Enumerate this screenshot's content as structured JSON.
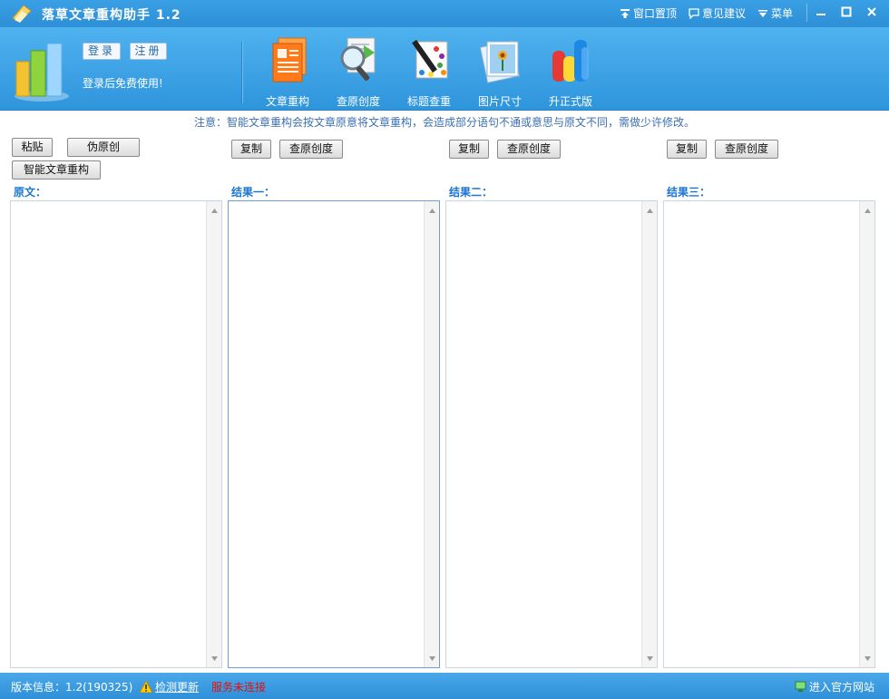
{
  "window": {
    "title": "落草文章重构助手 1.2",
    "actions": [
      {
        "label": "窗口置顶",
        "icon": "pin-icon"
      },
      {
        "label": "意见建议",
        "icon": "feedback-icon"
      },
      {
        "label": "菜单",
        "icon": "menu-chevron-icon"
      }
    ]
  },
  "account": {
    "login": "登录",
    "register": "注册",
    "hint": "登录后免费使用!"
  },
  "tools": [
    {
      "label": "文章重构",
      "icon": "document-icon"
    },
    {
      "label": "查原创度",
      "icon": "magnifier-icon"
    },
    {
      "label": "标题查重",
      "icon": "pen-palette-icon"
    },
    {
      "label": "图片尺寸",
      "icon": "picture-icon"
    },
    {
      "label": "升正式版",
      "icon": "upgrade-bars-icon"
    }
  ],
  "notice": "注意：智能文章重构会按文章原意将文章重构，会造成部分语句不通或意思与原文不同，需做少许修改。",
  "original": {
    "paste": "粘贴",
    "pseudo": "伪原创",
    "smart": "智能文章重构",
    "label": "原文："
  },
  "results": [
    {
      "label": "结果一：",
      "copy": "复制",
      "check": "查原创度"
    },
    {
      "label": "结果二：",
      "copy": "复制",
      "check": "查原创度"
    },
    {
      "label": "结果三：",
      "copy": "复制",
      "check": "查原创度"
    }
  ],
  "status": {
    "version": "版本信息：1.2(190325)",
    "check_update": "检测更新",
    "service": "服务未连接",
    "official_site": "进入官方网站"
  },
  "colors": {
    "accent": "#2d8fd6",
    "label_blue": "#1b76d1",
    "service_error": "#e01010"
  }
}
